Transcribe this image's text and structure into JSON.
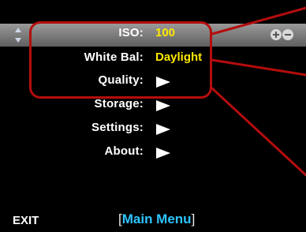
{
  "menu": {
    "items": [
      {
        "label": "ISO:",
        "value": "100"
      },
      {
        "label": "White Bal:",
        "value": "Daylight"
      },
      {
        "label": "Quality:",
        "value": ""
      },
      {
        "label": "Storage:",
        "value": ""
      },
      {
        "label": "Settings:",
        "value": ""
      },
      {
        "label": "About:",
        "value": ""
      }
    ]
  },
  "icons": {
    "scroll": "up-down-arrows-icon",
    "adjust": "plus-minus-icon",
    "submenu": "right-arrow-icon"
  },
  "bottom_bar": {
    "left_label": "EXIT",
    "title_open": "[",
    "title": "Main Menu",
    "title_close": "]"
  },
  "colors": {
    "accent": "#2ec5ff",
    "value": "#ffe800",
    "callout": "#b40d0d",
    "highlight": "#808080"
  }
}
